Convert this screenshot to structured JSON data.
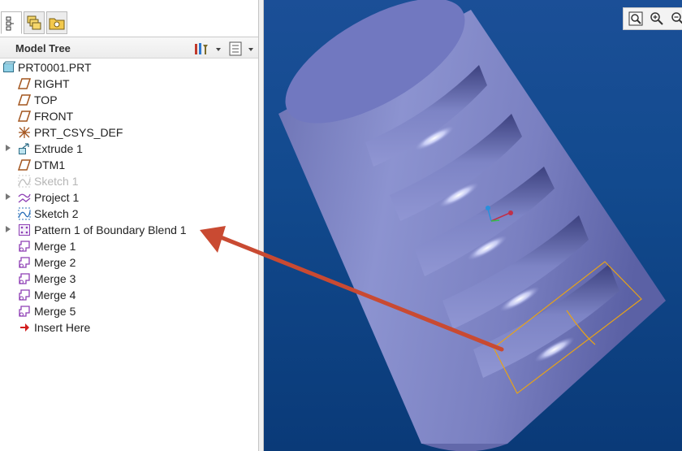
{
  "model_tree": {
    "title": "Model Tree",
    "tabs": [
      {
        "icon": "model-tree-tab-icon"
      },
      {
        "icon": "layers-tab-icon"
      },
      {
        "icon": "favorites-folder-tab-icon"
      }
    ],
    "header_buttons": [
      {
        "icon": "tree-settings-icon"
      },
      {
        "icon": "show-columns-icon"
      }
    ],
    "items": [
      {
        "label": "PRT0001.PRT",
        "icon": "part-icon",
        "level": 0,
        "expandable": false,
        "suppressed": false
      },
      {
        "label": "RIGHT",
        "icon": "datum-plane-icon",
        "level": 1,
        "expandable": false,
        "suppressed": false
      },
      {
        "label": "TOP",
        "icon": "datum-plane-icon",
        "level": 1,
        "expandable": false,
        "suppressed": false
      },
      {
        "label": "FRONT",
        "icon": "datum-plane-icon",
        "level": 1,
        "expandable": false,
        "suppressed": false
      },
      {
        "label": "PRT_CSYS_DEF",
        "icon": "coordinate-system-icon",
        "level": 1,
        "expandable": false,
        "suppressed": false
      },
      {
        "label": "Extrude 1",
        "icon": "extrude-icon",
        "level": 1,
        "expandable": true,
        "suppressed": false
      },
      {
        "label": "DTM1",
        "icon": "datum-plane-icon",
        "level": 1,
        "expandable": false,
        "suppressed": false
      },
      {
        "label": "Sketch 1",
        "icon": "sketch-icon",
        "level": 1,
        "expandable": false,
        "suppressed": true
      },
      {
        "label": "Project 1",
        "icon": "project-icon",
        "level": 1,
        "expandable": true,
        "suppressed": false
      },
      {
        "label": "Sketch 2",
        "icon": "sketch-icon",
        "level": 1,
        "expandable": false,
        "suppressed": false
      },
      {
        "label": "Pattern 1 of Boundary Blend 1",
        "icon": "pattern-icon",
        "level": 1,
        "expandable": true,
        "suppressed": false
      },
      {
        "label": "Merge 1",
        "icon": "merge-icon",
        "level": 1,
        "expandable": false,
        "suppressed": false
      },
      {
        "label": "Merge 2",
        "icon": "merge-icon",
        "level": 1,
        "expandable": false,
        "suppressed": false
      },
      {
        "label": "Merge 3",
        "icon": "merge-icon",
        "level": 1,
        "expandable": false,
        "suppressed": false
      },
      {
        "label": "Merge 4",
        "icon": "merge-icon",
        "level": 1,
        "expandable": false,
        "suppressed": false
      },
      {
        "label": "Merge 5",
        "icon": "merge-icon",
        "level": 1,
        "expandable": false,
        "suppressed": false
      },
      {
        "label": "Insert Here",
        "icon": "insert-here-arrow-icon",
        "level": 1,
        "expandable": false,
        "suppressed": false
      }
    ]
  },
  "graphics_toolbar": [
    {
      "icon": "refit-icon"
    },
    {
      "icon": "zoom-in-icon"
    },
    {
      "icon": "zoom-out-icon"
    }
  ],
  "annotation": {
    "icon": "callout-arrow",
    "color": "#c94a32"
  },
  "colors": {
    "viewport_background": "#124a8e",
    "model_surface": "#7f86c4",
    "selection_highlight": "#e8a317",
    "annotation_arrow": "#c94a32"
  }
}
